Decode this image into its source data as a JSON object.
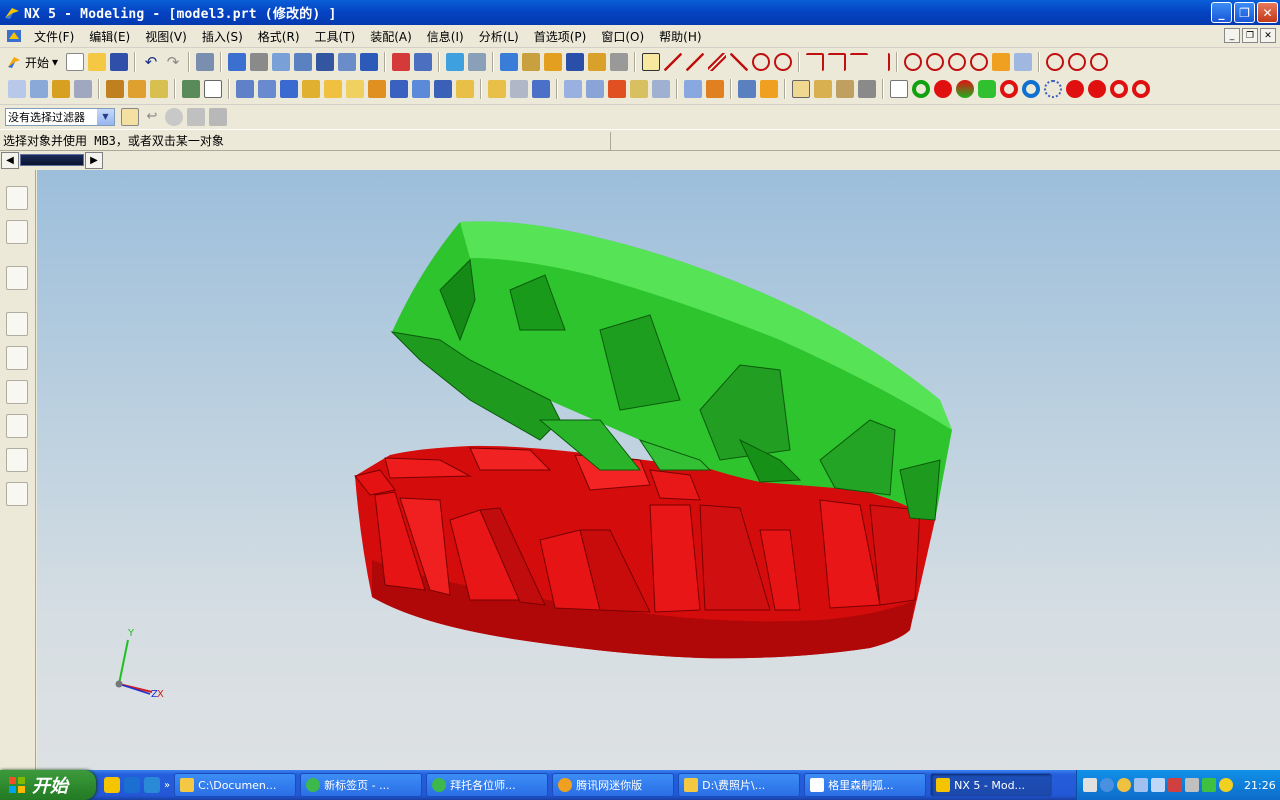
{
  "window": {
    "title": "NX 5 - Modeling - [model3.prt  (修改的) ]",
    "buttons": [
      "_",
      "❐",
      "✕"
    ]
  },
  "menubar": {
    "items": [
      "文件(F)",
      "编辑(E)",
      "视图(V)",
      "插入(S)",
      "格式(R)",
      "工具(T)",
      "装配(A)",
      "信息(I)",
      "分析(L)",
      "首选项(P)",
      "窗口(O)",
      "帮助(H)"
    ]
  },
  "toolbar": {
    "start_label": "开始"
  },
  "selection": {
    "filter_value": "没有选择过滤器"
  },
  "status": {
    "prompt": "选择对象并使用 MB3，或者双击某一对象"
  },
  "triad": {
    "y_label": "Y",
    "x_label": "X",
    "z_label": "Z",
    "x_color": "#d02020",
    "y_color": "#20c020",
    "z_color": "#2030d0"
  },
  "model": {
    "upper_gear_color": "#3ed63e",
    "lower_gear_color": "#e01010"
  },
  "taskbar": {
    "start_label": "开始",
    "tasks": [
      {
        "label": "C:\\Documen...",
        "icon": "folder-icon"
      },
      {
        "label": "新标签页 - ...",
        "icon": "browser-icon"
      },
      {
        "label": "拜托各位师...",
        "icon": "browser-icon"
      },
      {
        "label": "腾讯网迷你版",
        "icon": "qq-icon"
      },
      {
        "label": "D:\\费照片\\...",
        "icon": "folder-icon"
      },
      {
        "label": "格里森制弧...",
        "icon": "document-icon"
      },
      {
        "label": "NX 5 - Mod...",
        "icon": "nx-icon"
      }
    ],
    "clock": "21:26"
  }
}
